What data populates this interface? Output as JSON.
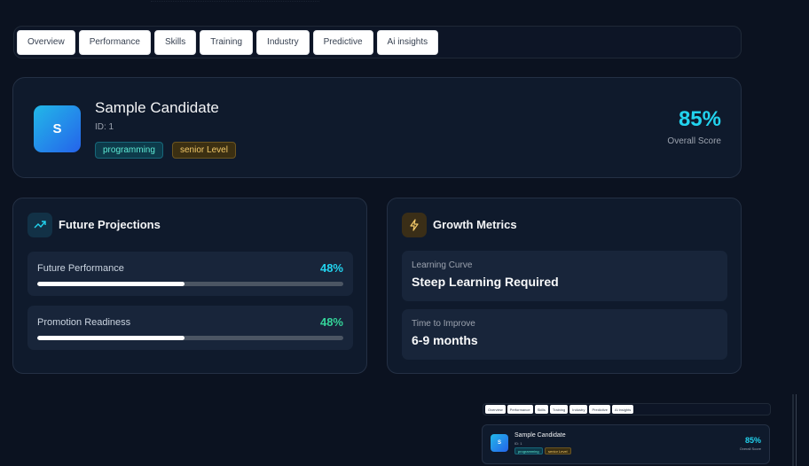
{
  "tabs": [
    {
      "label": "Overview"
    },
    {
      "label": "Performance"
    },
    {
      "label": "Skills"
    },
    {
      "label": "Training"
    },
    {
      "label": "Industry"
    },
    {
      "label": "Predictive"
    },
    {
      "label": "Ai insights"
    }
  ],
  "candidate": {
    "initial": "S",
    "name": "Sample Candidate",
    "id": "ID: 1",
    "badges": {
      "category": "programming",
      "level": "senior Level"
    },
    "score": "85%",
    "score_label": "Overall Score"
  },
  "future_projections": {
    "title": "Future Projections",
    "icon": "trending-up-icon",
    "items": [
      {
        "label": "Future Performance",
        "value": "48%",
        "fill": 0.48,
        "color": "#22d3ee"
      },
      {
        "label": "Promotion Readiness",
        "value": "48%",
        "fill": 0.48,
        "color": "#34d399"
      }
    ]
  },
  "growth_metrics": {
    "title": "Growth Metrics",
    "icon": "lightning-icon",
    "items": [
      {
        "label": "Learning Curve",
        "value": "Steep Learning Required"
      },
      {
        "label": "Time to Improve",
        "value": "6-9 months"
      }
    ]
  },
  "colors": {
    "accent_cyan": "#22d3ee",
    "accent_green": "#34d399",
    "warning": "#f3c969"
  }
}
